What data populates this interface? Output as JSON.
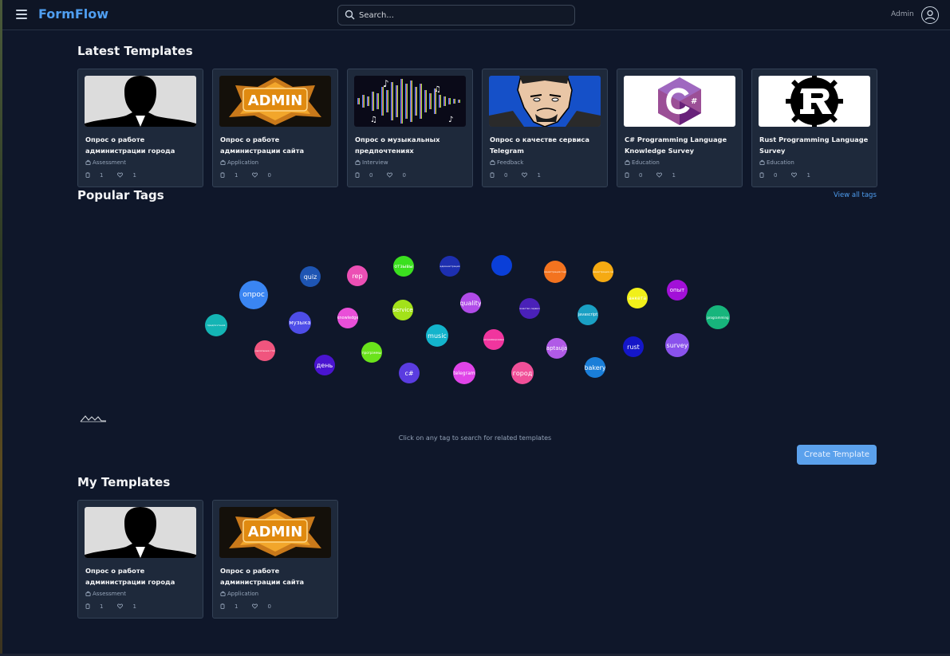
{
  "header": {
    "brand": "FormFlow",
    "search_placeholder": "Search...",
    "user_label": "Admin"
  },
  "latest": {
    "title": "Latest Templates",
    "cards": [
      {
        "title": "Опрос о работе администрации города",
        "category": "Assessment",
        "questions": "1",
        "likes": "1",
        "thumb": "silhouette"
      },
      {
        "title": "Опрос о работе администрации сайта",
        "category": "Application",
        "questions": "1",
        "likes": "0",
        "thumb": "admin"
      },
      {
        "title": "Опрос о музыкальных предпочтениях",
        "category": "Interview",
        "questions": "0",
        "likes": "0",
        "thumb": "music"
      },
      {
        "title": "Опрос о качестве сервиса Telegram",
        "category": "Feedback",
        "questions": "0",
        "likes": "1",
        "thumb": "face"
      },
      {
        "title": "C# Programming Language Knowledge Survey",
        "category": "Education",
        "questions": "0",
        "likes": "1",
        "thumb": "csharp"
      },
      {
        "title": "Rust Programming Language Survey",
        "category": "Education",
        "questions": "0",
        "likes": "1",
        "thumb": "rust"
      }
    ]
  },
  "tags_section": {
    "title": "Popular Tags",
    "view_all": "View all tags",
    "hint": "Click on any tag to search for related templates",
    "tags": [
      {
        "label": "quiz",
        "color": "#1e55b3",
        "fs": 8
      },
      {
        "label": "rep",
        "color": "#ec4fb4",
        "fs": 8
      },
      {
        "label": "отзывы",
        "color": "#3be01f",
        "fs": 6
      },
      {
        "label": "администрация",
        "color": "#1d2fb0",
        "fs": 3
      },
      {
        "label": "",
        "color": "#0a3fd8",
        "fs": 3
      },
      {
        "label": "администрация города",
        "color": "#f3731f",
        "fs": 3
      },
      {
        "label": "администрация сайта",
        "color": "#f5aa12",
        "fs": 3
      },
      {
        "label": "опрос",
        "color": "#3a85f2",
        "fs": 9
      },
      {
        "label": "музыка",
        "color": "#4e4de8",
        "fs": 7
      },
      {
        "label": "knowledge",
        "color": "#e94fd8",
        "fs": 5
      },
      {
        "label": "service",
        "color": "#a3e21a",
        "fs": 7
      },
      {
        "label": "quality",
        "color": "#b04be8",
        "fs": 8
      },
      {
        "label": "качество сервиса",
        "color": "#4a21b8",
        "fs": 3
      },
      {
        "label": "javascript",
        "color": "#1aa0c4",
        "fs": 5
      },
      {
        "label": "анкета",
        "color": "#f1f01a",
        "fs": 6
      },
      {
        "label": "опыт",
        "color": "#a210d8",
        "fs": 7
      },
      {
        "label": "предпочтения",
        "color": "#14b4b4",
        "fs": 3
      },
      {
        "label": "programming",
        "color": "#17b57c",
        "fs": 4
      },
      {
        "label": "музыкальные стили",
        "color": "#f0557e",
        "fs": 3
      },
      {
        "label": "music",
        "color": "#13b4cc",
        "fs": 8
      },
      {
        "label": "программирование",
        "color": "#f0359e",
        "fs": 3
      },
      {
        "label": "день",
        "color": "#4a14d0",
        "fs": 8
      },
      {
        "label": "программы",
        "color": "#6ae31b",
        "fs": 4
      },
      {
        "label": "c#",
        "color": "#5a3ce0",
        "fs": 8
      },
      {
        "label": "telegram",
        "color": "#e044e8",
        "fs": 6
      },
      {
        "label": "город",
        "color": "#f04f98",
        "fs": 8
      },
      {
        "label": "aptaujа",
        "color": "#b05ae6",
        "fs": 7
      },
      {
        "label": "bakery",
        "color": "#1a7ed8",
        "fs": 8
      },
      {
        "label": "rust",
        "color": "#1416c8",
        "fs": 8
      },
      {
        "label": "survey",
        "color": "#8a52ec",
        "fs": 8
      }
    ]
  },
  "actions": {
    "create_template": "Create Template"
  },
  "mine": {
    "title": "My Templates",
    "cards": [
      {
        "title": "Опрос о работе администрации города",
        "category": "Assessment",
        "questions": "1",
        "likes": "1",
        "thumb": "silhouette"
      },
      {
        "title": "Опрос о работе администрации сайта",
        "category": "Application",
        "questions": "1",
        "likes": "0",
        "thumb": "admin"
      }
    ]
  }
}
